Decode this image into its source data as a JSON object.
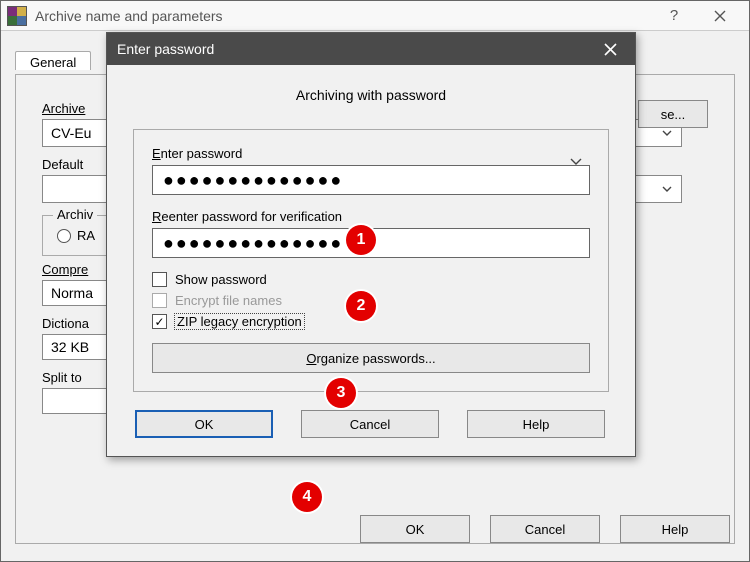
{
  "bg": {
    "title": "Archive name and parameters",
    "tab_general": "General",
    "archive_name_label": "Archive",
    "archive_name_value": "CV-Eu",
    "browse": "se...",
    "default_profile_label": "Default",
    "archive_format_legend": "Archiv",
    "radio_rar": "RA",
    "compression_label": "Compre",
    "compression_value": "Norma",
    "dictionary_label": "Dictiona",
    "dictionary_value": "32 KB",
    "split_label": "Split to",
    "ok": "OK",
    "cancel": "Cancel",
    "help": "Help"
  },
  "modal": {
    "title": "Enter password",
    "heading": "Archiving with password",
    "pwd_label_pre": "E",
    "pwd_label_rest": "nter password",
    "pwd_value": "●●●●●●●●●●●●●●",
    "reenter_label_pre": "R",
    "reenter_label_rest": "eenter password for verification",
    "reenter_value": "●●●●●●●●●●●●●●",
    "show_pre": "S",
    "show_rest": "how password",
    "encrypt_pre": "n",
    "encrypt_before": "Encrypt file ",
    "encrypt_rest": "ames",
    "zip_pre": "Z",
    "zip_rest": "IP legacy encryption",
    "organize": "Organize passwords...",
    "ok": "OK",
    "cancel": "Cancel",
    "help": "Help"
  },
  "badges": {
    "b1": "1",
    "b2": "2",
    "b3": "3",
    "b4": "4"
  }
}
